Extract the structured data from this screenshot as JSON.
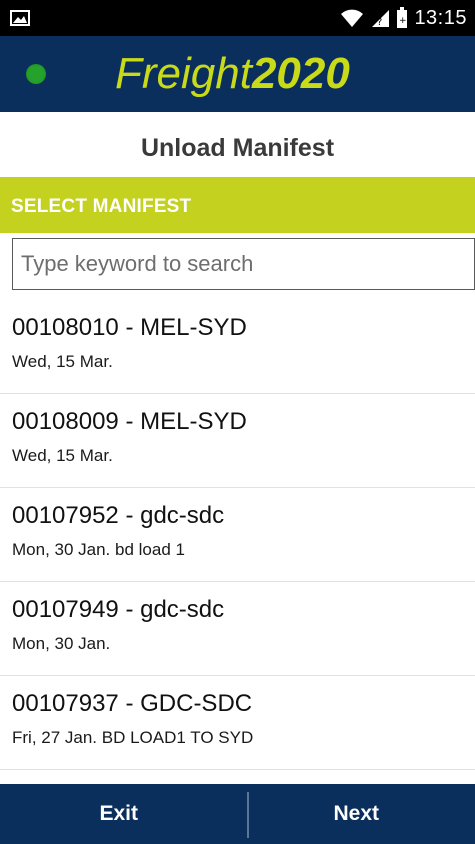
{
  "status_bar": {
    "time": "13:15",
    "icons": [
      "image-icon",
      "wifi-icon",
      "signal-icon",
      "battery-icon"
    ]
  },
  "header": {
    "logo_part1": "Freight",
    "logo_part2": "2020",
    "colors": {
      "background": "#0a2f5c",
      "logo": "#c9db18",
      "connection_dot": "#25a22b"
    }
  },
  "page": {
    "title": "Unload Manifest"
  },
  "section": {
    "label": "SELECT MANIFEST",
    "color": "#c4d11f"
  },
  "search": {
    "placeholder": "Type keyword to search",
    "value": ""
  },
  "manifests": [
    {
      "title": "00108010 - MEL-SYD",
      "subtitle": "Wed, 15 Mar."
    },
    {
      "title": "00108009 - MEL-SYD",
      "subtitle": "Wed, 15 Mar."
    },
    {
      "title": "00107952 - gdc-sdc",
      "subtitle": "Mon, 30 Jan. bd load 1"
    },
    {
      "title": "00107949 - gdc-sdc",
      "subtitle": "Mon, 30 Jan."
    },
    {
      "title": "00107937 - GDC-SDC",
      "subtitle": "Fri, 27 Jan. BD LOAD1 TO SYD"
    }
  ],
  "footer": {
    "exit_label": "Exit",
    "next_label": "Next"
  }
}
